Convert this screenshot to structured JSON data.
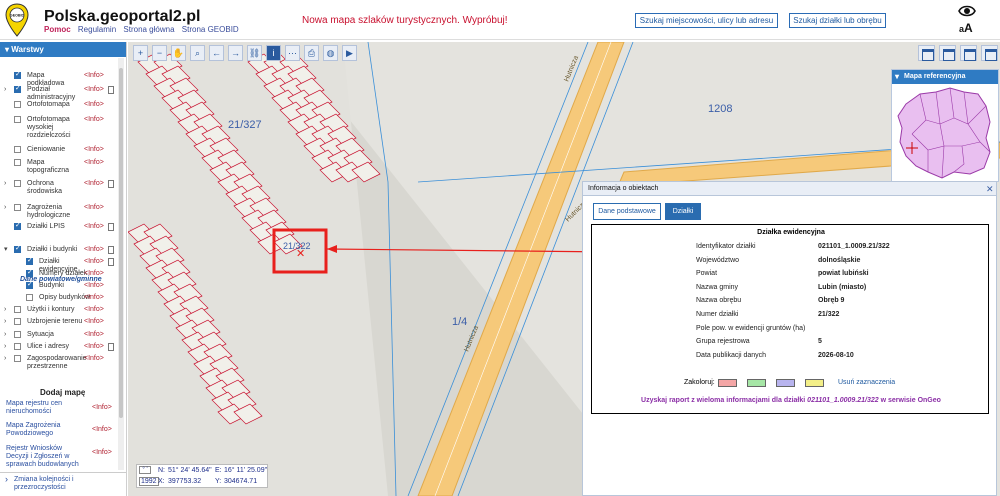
{
  "header": {
    "title": "Polska.geoportal2.pl",
    "links": [
      "Pomoc",
      "Regulamin",
      "Strona główna",
      "Strona GEOBID"
    ],
    "promo": "Nowa mapa szlaków turystycznych. Wypróbuj!",
    "search_place_button": "Szukaj miejscowości, ulicy lub adresu",
    "search_parcel_button": "Szukaj działki lub obrębu",
    "font_size_label": "A",
    "font_size_label_small": "a",
    "logo_text": "GEOBID"
  },
  "sidebar": {
    "header": "Warstwy",
    "layers": [
      {
        "label": "Mapa podkładowa",
        "info": "<Info>",
        "checked": true,
        "toggle": false,
        "doc": false,
        "indent": 0
      },
      {
        "label": "Podział administracyjny",
        "info": "<Info>",
        "checked": true,
        "toggle": true,
        "doc": true,
        "indent": 0
      },
      {
        "label": "Ortofotomapa",
        "info": "<Info>",
        "checked": false,
        "toggle": false,
        "doc": false,
        "indent": 0
      },
      {
        "label": "Ortofotomapa wysokiej rozdzielczości",
        "info": "<Info>",
        "checked": false,
        "toggle": false,
        "doc": false,
        "indent": 0
      },
      {
        "label": "Cieniowanie",
        "info": "<Info>",
        "checked": false,
        "toggle": false,
        "doc": false,
        "indent": 0
      },
      {
        "label": "Mapa topograficzna",
        "info": "<Info>",
        "checked": false,
        "toggle": false,
        "doc": false,
        "indent": 0
      },
      {
        "label": "Ochrona środowiska",
        "info": "<Info>",
        "checked": false,
        "toggle": true,
        "doc": true,
        "indent": 0
      },
      {
        "label": "Zagrożenia hydrologiczne",
        "info": "<Info>",
        "checked": false,
        "toggle": true,
        "doc": false,
        "indent": 0
      },
      {
        "label": "Działki LPIS",
        "info": "<Info>",
        "checked": true,
        "toggle": false,
        "doc": true,
        "indent": 0
      },
      {
        "label": "Działki i budynki",
        "info": "<Info>",
        "checked": true,
        "toggle": true,
        "doc": true,
        "indent": 0
      },
      {
        "label": "Działki ewidencyjne",
        "info": "<Info>",
        "checked": true,
        "toggle": false,
        "doc": true,
        "indent": 1
      },
      {
        "label": "Numery działek",
        "info": "<Info>",
        "checked": true,
        "toggle": false,
        "doc": false,
        "indent": 1
      },
      {
        "label": "Budynki",
        "info": "<Info>",
        "checked": true,
        "toggle": false,
        "doc": false,
        "indent": 1
      },
      {
        "label": "Opisy budynków",
        "info": "<Info>",
        "checked": false,
        "toggle": false,
        "doc": false,
        "indent": 1
      },
      {
        "label": "Użytki i kontury",
        "info": "<Info>",
        "checked": false,
        "toggle": true,
        "doc": false,
        "indent": 0
      },
      {
        "label": "Uzbrojenie terenu",
        "info": "<Info>",
        "checked": false,
        "toggle": true,
        "doc": false,
        "indent": 0
      },
      {
        "label": "Sytuacja",
        "info": "<Info>",
        "checked": false,
        "toggle": true,
        "doc": false,
        "indent": 0
      },
      {
        "label": "Ulice i adresy",
        "info": "<Info>",
        "checked": false,
        "toggle": true,
        "doc": true,
        "indent": 0
      },
      {
        "label": "Zagospodarowanie przestrzenne",
        "info": "<Info>",
        "checked": false,
        "toggle": true,
        "doc": false,
        "indent": 0
      }
    ],
    "dane_label": "Dane powiatowe/gminne",
    "dodaj_title": "Dodaj mapę",
    "add_maps": [
      {
        "label": "Mapa rejestru cen nieruchomości",
        "info": "<Info>"
      },
      {
        "label": "Mapa Zagrożenia Powodziowego",
        "info": "<Info>"
      },
      {
        "label": "Rejestr Wniosków Decyzji i Zgłoszeń w sprawach budowlanych",
        "info": "<Info>"
      }
    ],
    "zmiana": "Zmiana kolejności i przezroczystości"
  },
  "refmap": {
    "title": "Mapa referencyjna"
  },
  "map_labels": {
    "parcel_main": "21/327",
    "parcel_selected": "21/322",
    "road_number": "1208",
    "road_name": "Hutnicza",
    "parcel_14": "1/4"
  },
  "coords": {
    "n_label": "N:",
    "n": "51° 24' 45.64\"",
    "e_label": "E:",
    "e": "16° 11' 25.09\"",
    "x_label": "X:",
    "x": "397753.32",
    "y_label": "Y:",
    "y": "304674.71",
    "system": "1992"
  },
  "info": {
    "title": "Informacja o obiektach",
    "tab_basic": "Dane podstawowe",
    "tab_parcels": "Działki",
    "section_title": "Działka ewidencyjna",
    "fields": [
      {
        "label": "Identyfikator działki",
        "value": "021101_1.0009.21/322"
      },
      {
        "label": "Województwo",
        "value": "dolnośląskie"
      },
      {
        "label": "Powiat",
        "value": "powiat lubiński"
      },
      {
        "label": "Nazwa gminy",
        "value": "Lubin (miasto)"
      },
      {
        "label": "Nazwa obrębu",
        "value": "Obręb 9"
      },
      {
        "label": "Numer działki",
        "value": "21/322"
      },
      {
        "label": "Pole pow. w ewidencji gruntów (ha)",
        "value": ""
      },
      {
        "label": "Grupa rejestrowa",
        "value": "5"
      },
      {
        "label": "Data publikacji danych",
        "value": "2026-08-10"
      }
    ],
    "kolor_label": "Zakoloruj:",
    "swatches": [
      "#f4a6a6",
      "#a6e6a6",
      "#b8b4ee",
      "#f3ef88"
    ],
    "usun": "Usuń zaznaczenia",
    "raport_prefix": "Uzyskaj raport z wieloma informacjami dla działki",
    "raport_id": "021101_1.0009.21/322",
    "raport_suffix": "w serwisie OnGeo"
  }
}
